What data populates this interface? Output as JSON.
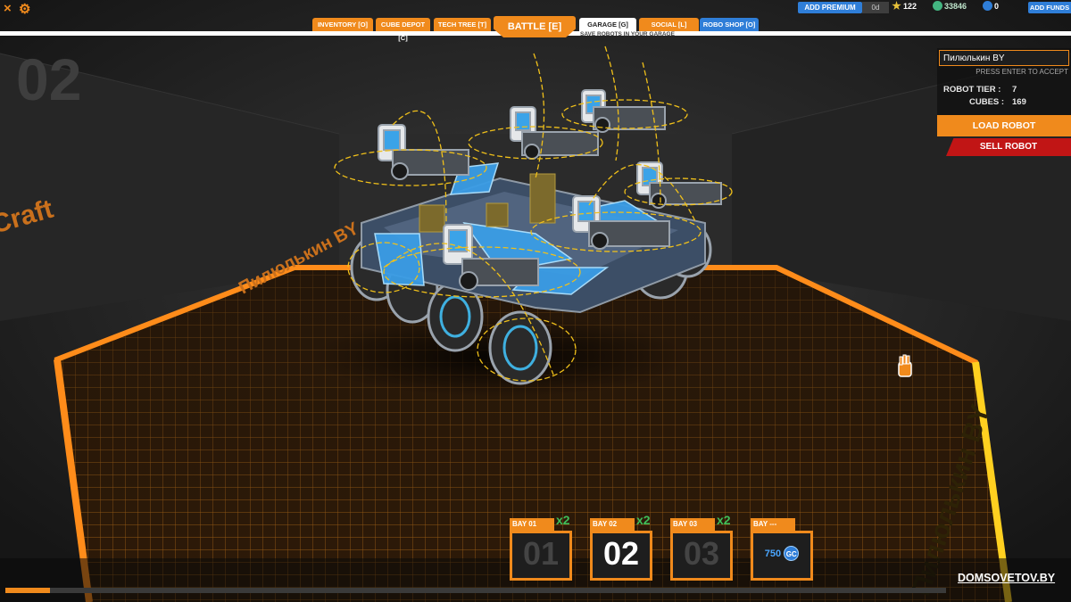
{
  "hud": {
    "close_icon": "×",
    "settings_icon": "⚙",
    "add_premium": "ADD PREMIUM",
    "premium_days": "0d",
    "tech_points": "122",
    "robits": "33846",
    "galaxy_credits": "0",
    "add_funds": "ADD FUNDS"
  },
  "tabs": [
    {
      "label": "INVENTORY [O]"
    },
    {
      "label": "CUBE DEPOT [C]"
    },
    {
      "label": "TECH TREE [T]"
    },
    {
      "label": "BATTLE [E]"
    },
    {
      "label": "GARAGE [G]"
    },
    {
      "label": "SOCIAL [L]"
    },
    {
      "label": "ROBO SHOP [O]"
    }
  ],
  "tab_hint": "SAVE ROBOTS IN YOUR GARAGE",
  "scene": {
    "bay_number": "02",
    "floor_text_left": "Craft",
    "floor_text_mid": "Пилюлькин BY",
    "floor_text_right": "Пилюлькин BY"
  },
  "robot_panel": {
    "name_value": "Пилюлькин BY",
    "name_hint": "PRESS ENTER TO ACCEPT",
    "tier_label": "ROBOT TIER :",
    "tier_value": "7",
    "cubes_label": "CUBES :",
    "cubes_value": "169",
    "load_label": "LOAD ROBOT",
    "sell_label": "SELL ROBOT"
  },
  "bays": [
    {
      "label": "BAY 01",
      "number": "01",
      "mult": "x2",
      "active": false
    },
    {
      "label": "BAY 02",
      "number": "02",
      "mult": "x2",
      "active": true
    },
    {
      "label": "BAY 03",
      "number": "03",
      "mult": "x2",
      "active": false
    },
    {
      "label": "BAY ---",
      "price": "750",
      "currency": "GC"
    }
  ],
  "progress": 0.047,
  "watermark": "DOMSOVETOV.BY",
  "colors": {
    "accent": "#f08a1c",
    "blue": "#2f7ed8",
    "danger": "#c11515",
    "green": "#3fbf5a"
  }
}
